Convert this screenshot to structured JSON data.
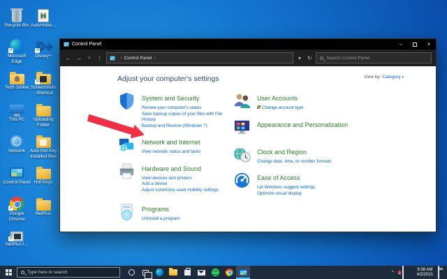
{
  "glyphs": {
    "back": "←",
    "forward": "→",
    "up": "↑",
    "dropdown": "▾",
    "refresh": "↻",
    "breadcrumb_chevron": "›",
    "minimize": "–",
    "close": "×",
    "tray_chevron": "^",
    "view_caret": "▾"
  },
  "desktop": {
    "icons": [
      {
        "label": "Recycle Bin",
        "icon": "recycle-bin-icon"
      },
      {
        "label": "AutoHotke...",
        "icon": "autohotkey-icon"
      },
      {
        "label": "Microsoft Edge",
        "icon": "edge-icon"
      },
      {
        "label": "Disney+",
        "icon": "disney-plus-icon"
      },
      {
        "label": "Tech Junkie",
        "icon": "folder-person-icon"
      },
      {
        "label": "Screenshots - Shortcut",
        "icon": "folder-screenshots-icon"
      },
      {
        "label": "This PC",
        "icon": "this-pc-icon"
      },
      {
        "label": "Uploading Folder",
        "icon": "folder-icon"
      },
      {
        "label": "Network",
        "icon": "network-icon"
      },
      {
        "label": "Auto Hot Key installed files",
        "icon": "folder-files-icon"
      },
      {
        "label": "Control Panel",
        "icon": "control-panel-icon"
      },
      {
        "label": "Hot Keys",
        "icon": "folder-icon"
      },
      {
        "label": "Google Chrome",
        "icon": "chrome-icon"
      },
      {
        "label": "NetPlus",
        "icon": "folder-icon"
      },
      {
        "label": "NetPlus I...",
        "icon": "installer-icon"
      }
    ]
  },
  "window": {
    "title": "Control Panel",
    "breadcrumb": "Control Panel",
    "search_placeholder": "Search Control Panel",
    "header": "Adjust your computer's settings",
    "view_by_label": "View by:",
    "view_by_value": "Category"
  },
  "categories": {
    "left": [
      {
        "title": "System and Security",
        "icon": "shield-icon",
        "links": [
          "Review your computer's status",
          "Save backup copies of your files with File History",
          "Backup and Restore (Windows 7)"
        ]
      },
      {
        "title": "Network and Internet",
        "icon": "network-monitors-icon",
        "links": [
          "View network status and tasks"
        ]
      },
      {
        "title": "Hardware and Sound",
        "icon": "printer-icon",
        "links": [
          "View devices and printers",
          "Add a device",
          "Adjust commonly used mobility settings"
        ]
      },
      {
        "title": "Programs",
        "icon": "programs-icon",
        "links": [
          "Uninstall a program"
        ]
      }
    ],
    "right": [
      {
        "title": "User Accounts",
        "icon": "users-icon",
        "links": [
          "Change account type"
        ]
      },
      {
        "title": "Appearance and Personalization",
        "icon": "personalization-icon",
        "links": []
      },
      {
        "title": "Clock and Region",
        "icon": "clock-region-icon",
        "links": [
          "Change date, time, or number formats"
        ]
      },
      {
        "title": "Ease of Access",
        "icon": "ease-of-access-icon",
        "links": [
          "Let Windows suggest settings",
          "Optimize visual display"
        ]
      }
    ]
  },
  "annotation": {
    "arrow_color": "#ee3147",
    "target": "Hardware and Sound"
  },
  "taskbar": {
    "search_placeholder": "Type here to search",
    "clock": {
      "time": "9:38 AM",
      "date": "4/2/2021"
    }
  }
}
